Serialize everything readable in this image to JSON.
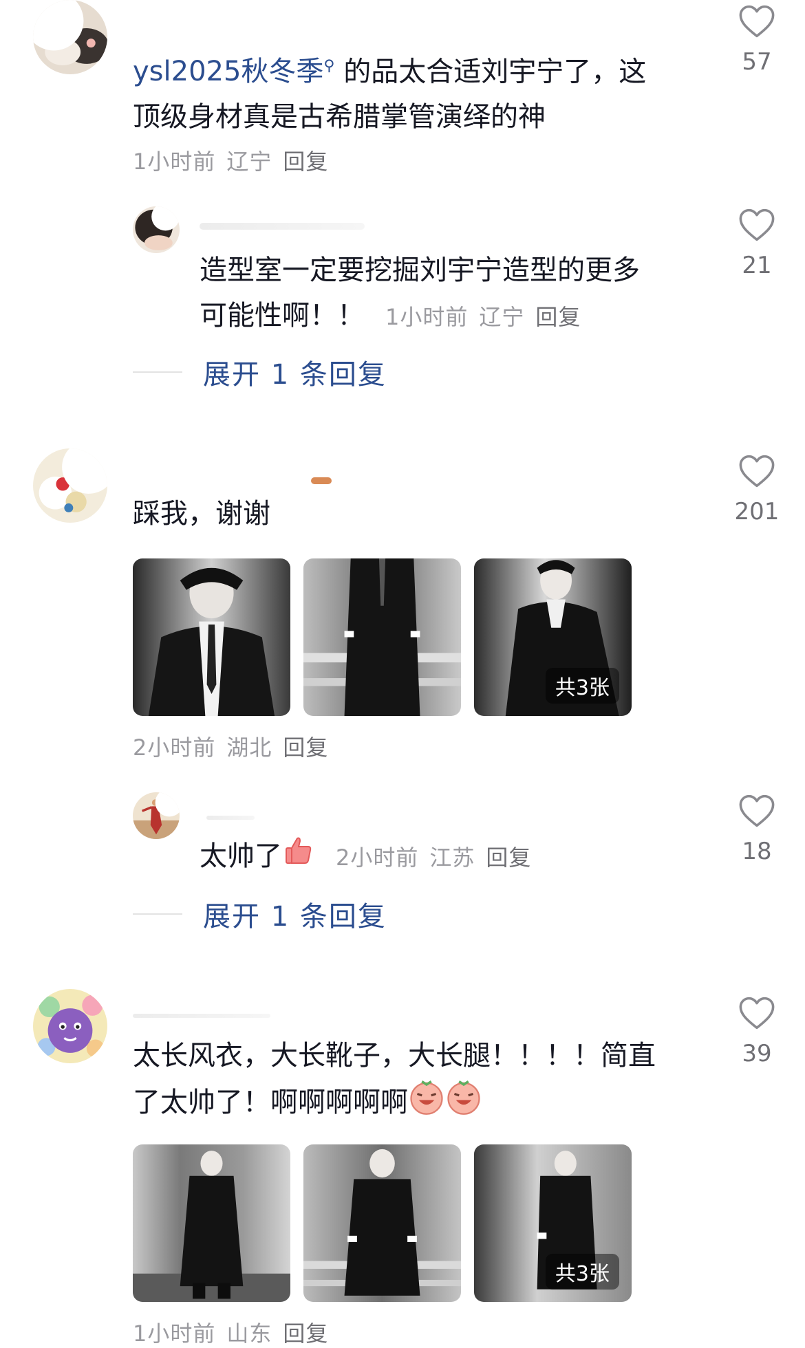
{
  "comments": [
    {
      "text_link": "ysl2025秋冬季",
      "text_rest": "的品太合适刘宇宁了，这顶级身材真是古希腊掌管演绎的神",
      "text_line2": "顶级身材真是古希腊掌管演绎的神",
      "time": "1小时前",
      "location": "辽宁",
      "reply_label": "回复",
      "likes": "57",
      "replies": [
        {
          "text_line1": "造型室一定要挖掘刘宇宁造型的更多",
          "text_line2": "可能性啊！！",
          "time": "1小时前",
          "location": "辽宁",
          "reply_label": "回复",
          "likes": "21"
        }
      ],
      "expand_label": "展开 1 条回复"
    },
    {
      "text": "踩我，谢谢",
      "likes": "201",
      "photo_count_badge": "共3张",
      "time": "2小时前",
      "location": "湖北",
      "reply_label": "回复",
      "replies": [
        {
          "text": "太帅了",
          "time": "2小时前",
          "location": "江苏",
          "reply_label": "回复",
          "likes": "18"
        }
      ],
      "expand_label": "展开 1 条回复"
    },
    {
      "text_line1": "太长风衣，大长靴子，大长腿！！！！简直",
      "text_line2": "了太帅了！啊啊啊啊啊",
      "likes": "39",
      "photo_count_badge": "共3张",
      "time": "1小时前",
      "location": "山东",
      "reply_label": "回复"
    }
  ],
  "icons": {
    "like": "heart-outline-icon",
    "search_suffix": "search-icon",
    "emoji_thumbs": "thumbs-up-emoji",
    "emoji_laugh": "laughing-emoji"
  },
  "colors": {
    "link": "#2b4d8f",
    "meta": "#9a9a9f",
    "text": "#161823",
    "like_icon": "#8a8a8f"
  }
}
